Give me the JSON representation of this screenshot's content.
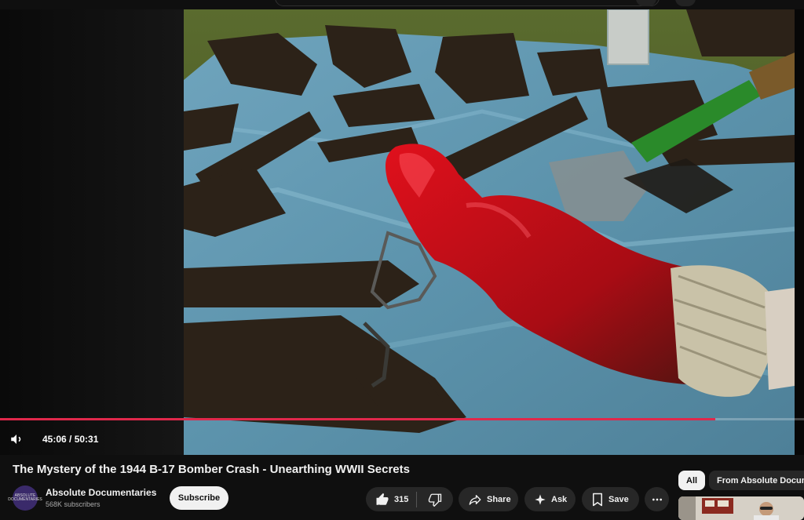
{
  "video": {
    "current_time": "45:06",
    "duration": "50:31",
    "time_display": "45:06 / 50:31",
    "progress_fraction": 0.89,
    "progress_color": "#e0284b"
  },
  "meta": {
    "title": "The Mystery of the 1944 B-17 Bomber Crash - Unearthing WWII Secrets",
    "channel": "Absolute Documentaries",
    "subscribers": "568K subscribers",
    "avatar_text": "ABSOLUTE DOCUMENTARIES"
  },
  "actions": {
    "subscribe": "Subscribe",
    "likes": "315",
    "share": "Share",
    "ask": "Ask",
    "save": "Save"
  },
  "chips": {
    "all": "All",
    "from_channel": "From Absolute Documentaries"
  },
  "icons": [
    "volume-icon",
    "like-icon",
    "dislike-icon",
    "share-icon",
    "ask-sparkle-icon",
    "save-icon",
    "more-icon"
  ]
}
